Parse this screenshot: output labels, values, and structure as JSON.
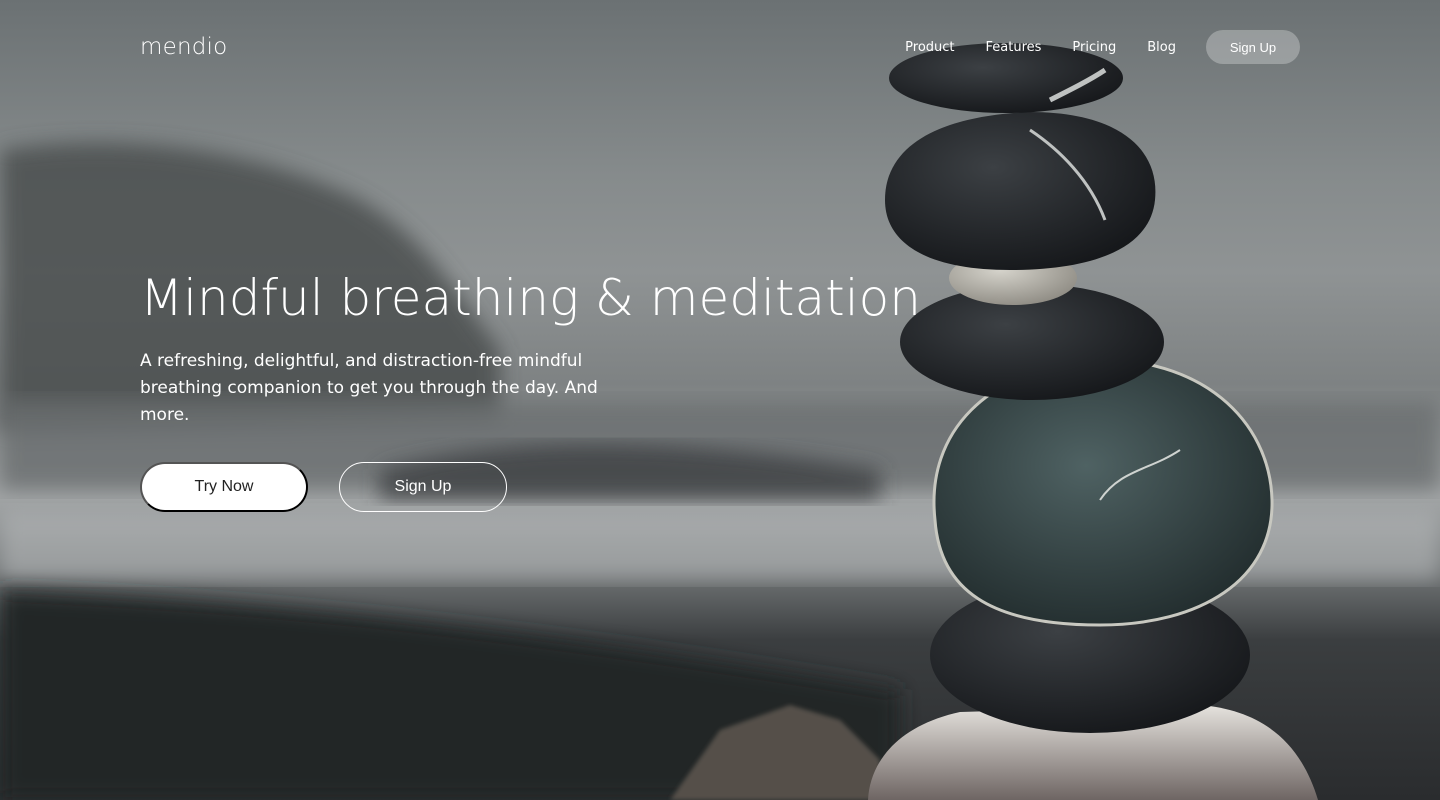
{
  "brand": {
    "logo_text": "mendio"
  },
  "nav": {
    "links": [
      {
        "label": "Product"
      },
      {
        "label": "Features"
      },
      {
        "label": "Pricing"
      },
      {
        "label": "Blog"
      }
    ],
    "signup_label": "Sign Up"
  },
  "hero": {
    "headline": "Mindful breathing & meditation",
    "subheadline": "A refreshing, delightful, and distraction-free mindful breathing companion to get you through the day. And more.",
    "primary_cta": "Try Now",
    "secondary_cta": "Sign Up",
    "background_image": "stacked-stones-on-beach"
  },
  "colors": {
    "text": "#ffffff",
    "primary_button_bg": "#ffffff",
    "primary_button_text": "#222222"
  }
}
